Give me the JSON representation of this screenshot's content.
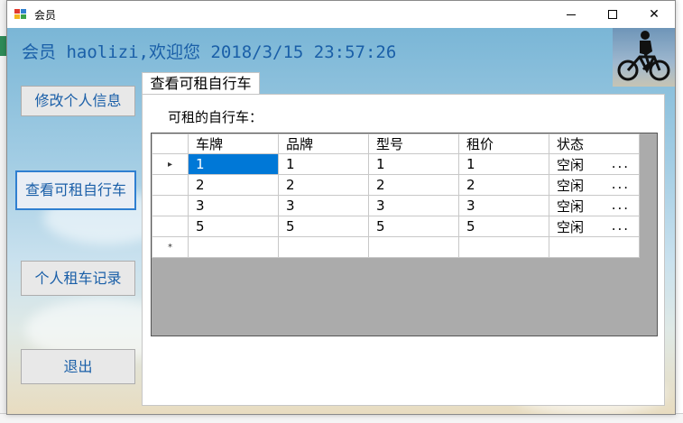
{
  "window": {
    "title": "会员"
  },
  "header": {
    "welcome": "会员 haolizi,欢迎您  2018/3/15 23:57:26"
  },
  "sidebar": {
    "items": [
      {
        "label": "修改个人信息"
      },
      {
        "label": "查看可租自行车"
      },
      {
        "label": "个人租车记录"
      },
      {
        "label": "退出"
      }
    ]
  },
  "tab": {
    "label": "查看可租自行车"
  },
  "grid": {
    "title": "可租的自行车：",
    "columns": [
      "车牌",
      "品牌",
      "型号",
      "租价",
      "状态"
    ],
    "rows": [
      {
        "plate": "1",
        "brand": "1",
        "model": "1",
        "price": "1",
        "status": "空闲",
        "more": "..."
      },
      {
        "plate": "2",
        "brand": "2",
        "model": "2",
        "price": "2",
        "status": "空闲",
        "more": "..."
      },
      {
        "plate": "3",
        "brand": "3",
        "model": "3",
        "price": "3",
        "status": "空闲",
        "more": "..."
      },
      {
        "plate": "5",
        "brand": "5",
        "model": "5",
        "price": "5",
        "status": "空闲",
        "more": "..."
      }
    ],
    "current_row_marker": "▸",
    "new_row_marker": "*"
  },
  "colors": {
    "accent": "#1a5fa8",
    "selection": "#0078d7",
    "focus_border": "#2f7fd0"
  },
  "icons": {
    "app": "app-icon",
    "banner": "cyclist-banner-image"
  }
}
